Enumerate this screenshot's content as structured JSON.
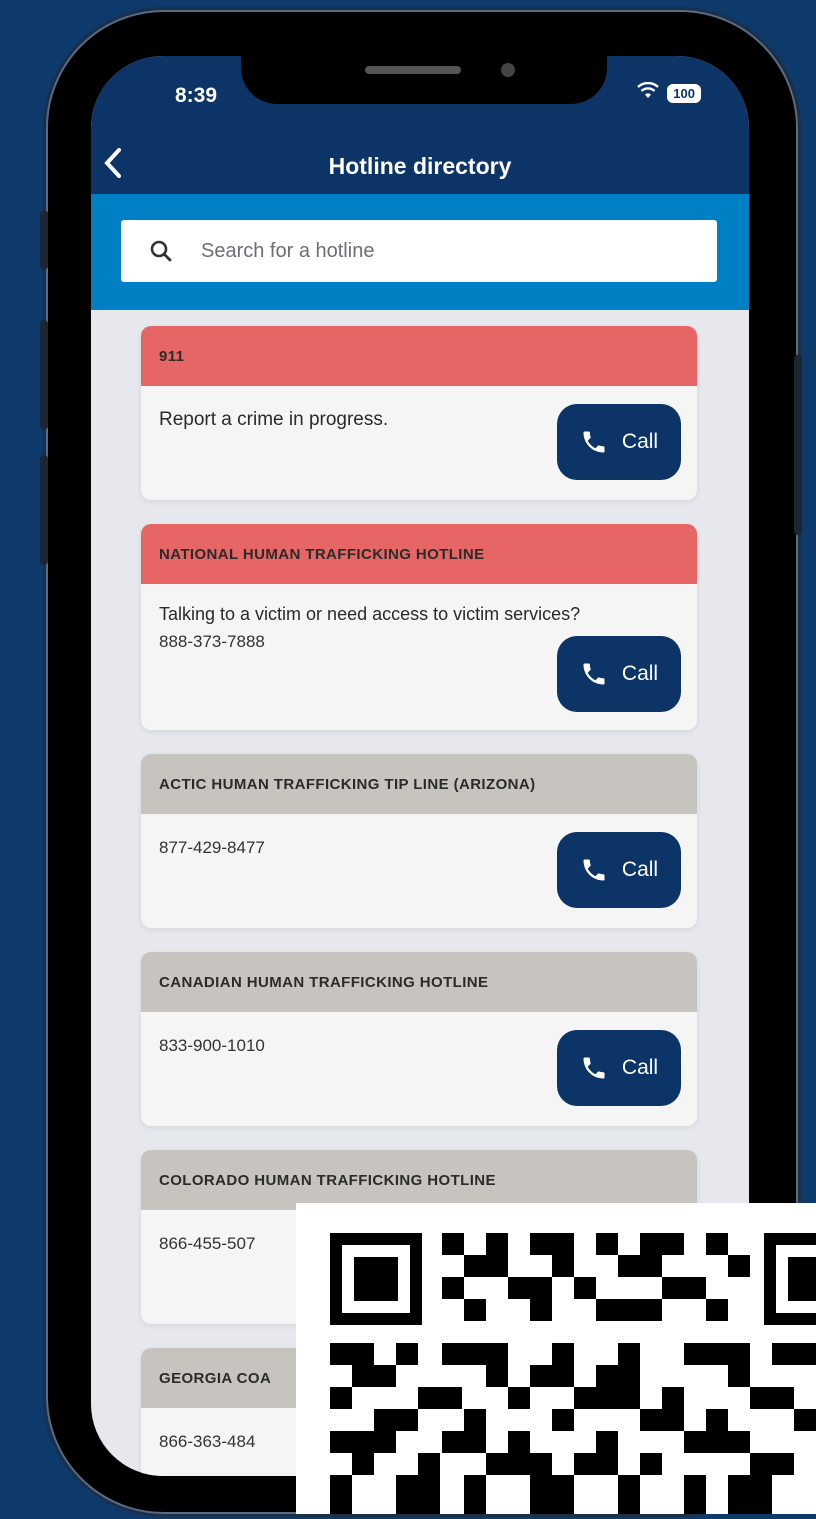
{
  "status_bar": {
    "time": "8:39",
    "battery": "100"
  },
  "nav": {
    "title": "Hotline directory"
  },
  "search": {
    "placeholder": "Search for a hotline"
  },
  "call_label": "Call",
  "hotlines": [
    {
      "title": "911",
      "desc": "Report a crime in progress.",
      "number": "",
      "urgent": true
    },
    {
      "title": "NATIONAL HUMAN TRAFFICKING HOTLINE",
      "desc": "Talking to a victim or need access to victim services?",
      "number": "888-373-7888",
      "urgent": true
    },
    {
      "title": "ACTIC HUMAN TRAFFICKING TIP LINE (ARIZONA)",
      "desc": "",
      "number": "877-429-8477",
      "urgent": false
    },
    {
      "title": "CANADIAN HUMAN TRAFFICKING HOTLINE",
      "desc": "",
      "number": "833-900-1010",
      "urgent": false
    },
    {
      "title": "COLORADO HUMAN TRAFFICKING HOTLINE",
      "desc": "",
      "number": "866-455-507",
      "urgent": false
    },
    {
      "title": "GEORGIA COA",
      "desc": "",
      "number": "866-363-484",
      "urgent": false
    }
  ],
  "colors": {
    "navy": "#0c3466",
    "accent_blue": "#0080c4",
    "urgent_red": "#e66565",
    "neutral_gray": "#c7c4bf",
    "background": "#0d3a6a"
  }
}
